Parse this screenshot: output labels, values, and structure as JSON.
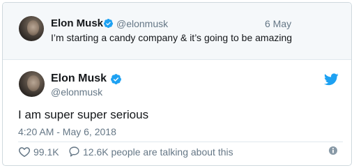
{
  "parent_tweet": {
    "author_name": "Elon Musk",
    "handle": "@elonmusk",
    "date": "6 May",
    "text": "I’m starting a candy company & it’s going to be amazing"
  },
  "main_tweet": {
    "author_name": "Elon Musk",
    "handle": "@elonmusk",
    "text": "I am super super serious",
    "timestamp": "4:20 AM - May 6, 2018",
    "likes": "99.1K",
    "conversation": "12.6K people are talking about this"
  },
  "colors": {
    "verified_blue": "#1da1f2",
    "twitter_blue": "#1da1f2",
    "secondary_text": "#657786",
    "primary_text": "#14171a",
    "parent_bg": "#f5f8fa"
  },
  "icons": {
    "verified": "verified-badge-icon",
    "brand": "twitter-bird-icon",
    "like": "heart-icon",
    "reply": "speech-bubble-icon",
    "info": "info-icon"
  }
}
